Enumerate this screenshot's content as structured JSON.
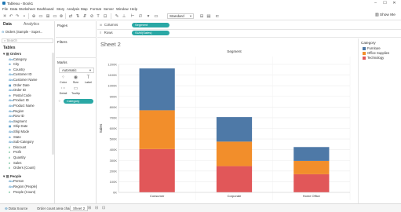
{
  "window": {
    "title": "Tableau - Book1",
    "min": "–",
    "max": "☐",
    "close": "✕"
  },
  "menu": [
    "File",
    "Data",
    "Worksheet",
    "Dashboard",
    "Story",
    "Analysis",
    "Map",
    "Format",
    "Server",
    "Window",
    "Help"
  ],
  "toolbar": {
    "fit": "Standard",
    "show_me": "Show Me"
  },
  "data_pane": {
    "tab_data": "Data",
    "tab_analytics": "Analytics",
    "datasource": "Orders (Sample - Super...",
    "search_placeholder": "Search",
    "tables_heading": "Tables",
    "groups": [
      {
        "name": "Orders",
        "fields": [
          {
            "name": "Category",
            "kind": "dim",
            "icon": "Abc"
          },
          {
            "name": "City",
            "kind": "dim",
            "icon": "⊕"
          },
          {
            "name": "Country",
            "kind": "dim",
            "icon": "⊕"
          },
          {
            "name": "Customer ID",
            "kind": "dim",
            "icon": "Abc"
          },
          {
            "name": "Customer Name",
            "kind": "dim",
            "icon": "Abc"
          },
          {
            "name": "Order Date",
            "kind": "dim",
            "icon": "▦"
          },
          {
            "name": "Order ID",
            "kind": "dim",
            "icon": "Abc"
          },
          {
            "name": "Postal Code",
            "kind": "dim",
            "icon": "⊕"
          },
          {
            "name": "Product ID",
            "kind": "dim",
            "icon": "Abc"
          },
          {
            "name": "Product Name",
            "kind": "dim",
            "icon": "Abc"
          },
          {
            "name": "Region",
            "kind": "dim",
            "icon": "Abc"
          },
          {
            "name": "Row ID",
            "kind": "dim",
            "icon": "Abc"
          },
          {
            "name": "Segment",
            "kind": "dim",
            "icon": "Abc"
          },
          {
            "name": "Ship Date",
            "kind": "dim",
            "icon": "▦"
          },
          {
            "name": "Ship Mode",
            "kind": "dim",
            "icon": "Abc"
          },
          {
            "name": "State",
            "kind": "dim",
            "icon": "⊕"
          },
          {
            "name": "Sub-Category",
            "kind": "dim",
            "icon": "Abc"
          },
          {
            "name": "Discount",
            "kind": "mea",
            "icon": "#"
          },
          {
            "name": "Profit",
            "kind": "mea",
            "icon": "#"
          },
          {
            "name": "Quantity",
            "kind": "mea",
            "icon": "#"
          },
          {
            "name": "Sales",
            "kind": "mea",
            "icon": "#"
          },
          {
            "name": "Orders (Count)",
            "kind": "mea",
            "icon": "#"
          }
        ]
      },
      {
        "name": "People",
        "fields": [
          {
            "name": "Person",
            "kind": "dim",
            "icon": "Abc"
          },
          {
            "name": "Region (People)",
            "kind": "dim",
            "icon": "Abc"
          },
          {
            "name": "People (Count)",
            "kind": "mea",
            "icon": "#"
          }
        ]
      }
    ]
  },
  "cards": {
    "pages": "Pages",
    "filters": "Filters",
    "marks": "Marks",
    "mark_type": "Automatic",
    "buttons": [
      {
        "label": "Color",
        "glyph": "⁘"
      },
      {
        "label": "Size",
        "glyph": "◉"
      },
      {
        "label": "Label",
        "glyph": "T"
      },
      {
        "label": "Detail",
        "glyph": "⋯"
      },
      {
        "label": "Tooltip",
        "glyph": "▭"
      }
    ],
    "color_pill": "Category",
    "color_pill_icon": "⁘"
  },
  "shelves": {
    "columns_label": "Columns",
    "columns_icon": "iii",
    "columns_pill": "Segment",
    "rows_label": "Rows",
    "rows_icon": "≡",
    "rows_pill": "SUM(Sales)"
  },
  "sheet": {
    "title": "Sheet 2"
  },
  "legend": {
    "title": "Category",
    "items": [
      {
        "name": "Furniture",
        "color": "#4e79a7"
      },
      {
        "name": "Office Supplies",
        "color": "#f28e2b"
      },
      {
        "name": "Technology",
        "color": "#e15759"
      }
    ]
  },
  "bottom": {
    "datasource_tab": "Data Source",
    "datasource_icon": "⊖",
    "tabs": [
      "Order count area chart",
      "Sheet 2"
    ],
    "active_tab": "Sheet 2",
    "new_sheet_icons": [
      "⊞",
      "⊟",
      "⊡"
    ]
  },
  "chart_data": {
    "type": "bar",
    "stacked": true,
    "title": "Segment",
    "ylabel": "Sales",
    "categories": [
      "Consumer",
      "Corporate",
      "Home Office"
    ],
    "series": [
      {
        "name": "Technology",
        "values": [
          406000,
          246000,
          170000
        ],
        "color": "#e15759"
      },
      {
        "name": "Office Supplies",
        "values": [
          364000,
          230000,
          125000
        ],
        "color": "#f28e2b"
      },
      {
        "name": "Furniture",
        "values": [
          392000,
          230000,
          130000
        ],
        "color": "#4e79a7"
      }
    ],
    "ylim": [
      0,
      1200000
    ],
    "yticks": [
      0,
      100000,
      200000,
      300000,
      400000,
      500000,
      600000,
      700000,
      800000,
      900000,
      1000000,
      1100000,
      1200000
    ],
    "ytick_labels": [
      "0K",
      "100K",
      "200K",
      "300K",
      "400K",
      "500K",
      "600K",
      "700K",
      "800K",
      "900K",
      "1000K",
      "1100K",
      "1200K"
    ],
    "grid": true
  }
}
